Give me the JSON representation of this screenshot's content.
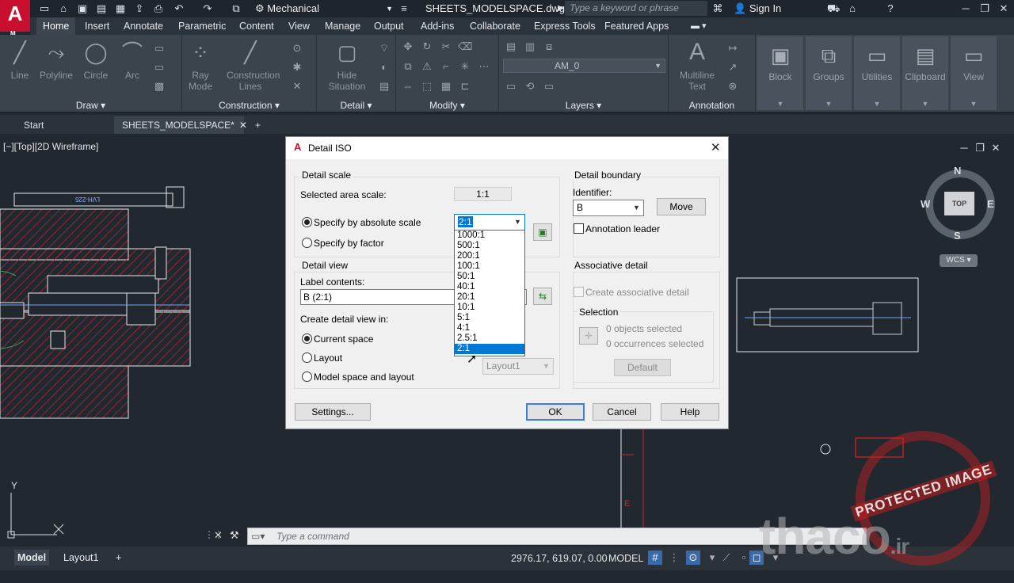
{
  "app": {
    "logo_letter": "A",
    "logo_sub": "M"
  },
  "titlebar": {
    "workspace": "Mechanical",
    "document": "SHEETS_MODELSPACE.dwg",
    "search_placeholder": "Type a keyword or phrase",
    "signin": "Sign In"
  },
  "ribbon_tabs": [
    "Home",
    "Insert",
    "Annotate",
    "Parametric",
    "Content",
    "View",
    "Manage",
    "Output",
    "Add-ins",
    "Collaborate",
    "Express Tools",
    "Featured Apps"
  ],
  "ribbon": {
    "draw": {
      "title": "Draw",
      "tools": [
        "Line",
        "Polyline",
        "Circle",
        "Arc"
      ]
    },
    "construction": {
      "title": "Construction",
      "tools": [
        "Ray Mode",
        "Construction Lines"
      ]
    },
    "detail": {
      "title": "Detail",
      "tools": [
        "Hide Situation"
      ]
    },
    "modify": {
      "title": "Modify"
    },
    "layers": {
      "title": "Layers",
      "current_layer": "AM_0"
    },
    "annotation": {
      "title": "Annotation",
      "tools": [
        "Multiline Text"
      ]
    },
    "right_tools": [
      "Block",
      "Groups",
      "Utilities",
      "Clipboard",
      "View"
    ]
  },
  "file_tabs": {
    "start": "Start",
    "active": "SHEETS_MODELSPACE*"
  },
  "viewport": {
    "label": "[−][Top][2D Wireframe]",
    "viewcube": {
      "n": "N",
      "s": "S",
      "e": "E",
      "w": "W",
      "top": "TOP",
      "wcs": "WCS"
    },
    "ucs_y": "Y",
    "mark_e": "E",
    "part_text": "LVH-225"
  },
  "dialog": {
    "title": "Detail ISO",
    "detail_scale": {
      "group": "Detail scale",
      "selected_area_label": "Selected area scale:",
      "selected_area_value": "1:1",
      "absolute_label": "Specify by absolute scale",
      "factor_label": "Specify by factor",
      "scale_value": "2:1",
      "options": [
        "1000:1",
        "500:1",
        "200:1",
        "100:1",
        "50:1",
        "40:1",
        "20:1",
        "10:1",
        "5:1",
        "4:1",
        "2.5:1",
        "2:1"
      ],
      "selected_option": "2:1"
    },
    "detail_view": {
      "group": "Detail view",
      "label_contents_label": "Label contents:",
      "label_contents_value": "B (2:1)",
      "create_in_label": "Create detail view in:",
      "current_space": "Current space",
      "layout": "Layout",
      "model_and_layout": "Model space and layout",
      "layout_combo": "Layout1"
    },
    "detail_boundary": {
      "group": "Detail boundary",
      "identifier_label": "Identifier:",
      "identifier_value": "B",
      "move_button": "Move",
      "annotation_leader": "Annotation leader"
    },
    "associative": {
      "group": "Associative detail",
      "create_label": "Create associative detail",
      "selection_group": "Selection",
      "objects": "0 objects selected",
      "occurrences": "0 occurrences selected",
      "default_button": "Default"
    },
    "buttons": {
      "settings": "Settings...",
      "ok": "OK",
      "cancel": "Cancel",
      "help": "Help"
    }
  },
  "command_line": {
    "placeholder": "Type  a  command"
  },
  "status": {
    "model_tab": "Model",
    "layout_tab": "Layout1",
    "coords": "2976.17, 619.07, 0.00",
    "mode": "MODEL"
  },
  "watermark": {
    "stamp": "PROTECTED IMAGE",
    "brand": "thaco",
    "brand_tld": ".ir"
  },
  "colors": {
    "accent": "#0078d7",
    "logo": "#c8102e",
    "hatch": "#c0262d",
    "ribbon": "#3b434d",
    "canvas": "#212830"
  }
}
